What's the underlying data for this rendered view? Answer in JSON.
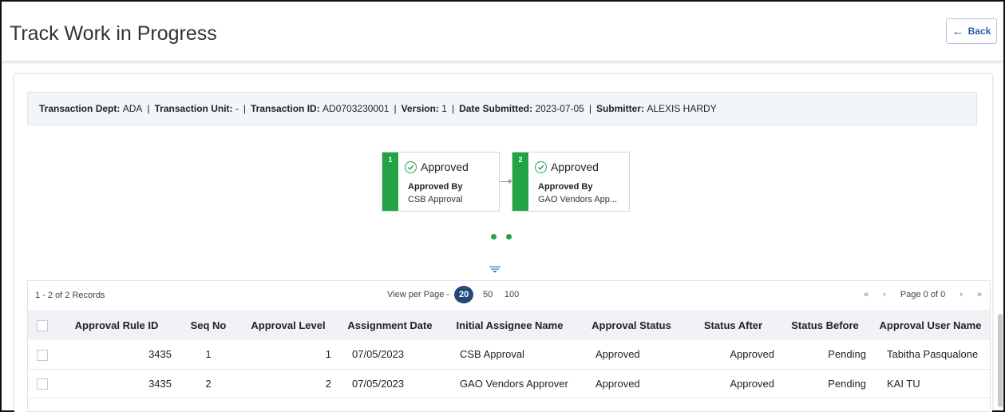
{
  "header": {
    "title": "Track Work in Progress",
    "back_label": "Back"
  },
  "summary": {
    "dept_label": "Transaction Dept:",
    "dept_value": "ADA",
    "unit_label": "Transaction Unit:",
    "unit_value": "-",
    "id_label": "Transaction ID:",
    "id_value": "AD0703230001",
    "version_label": "Version:",
    "version_value": "1",
    "date_label": "Date Submitted:",
    "date_value": "2023-07-05",
    "submitter_label": "Submitter:",
    "submitter_value": "ALEXIS HARDY",
    "separator": "|"
  },
  "workflow": {
    "steps": [
      {
        "number": "1",
        "status": "Approved",
        "by_label": "Approved By",
        "approver": "CSB Approval"
      },
      {
        "number": "2",
        "status": "Approved",
        "by_label": "Approved By",
        "approver": "GAO Vendors App..."
      }
    ]
  },
  "pager": {
    "records": "1 - 2 of 2 Records",
    "view_per_page": "View per Page -",
    "options": [
      "20",
      "50",
      "100"
    ],
    "selected": "20",
    "page_text": "Page 0 of 0"
  },
  "table": {
    "columns": [
      "Approval Rule ID",
      "Seq No",
      "Approval Level",
      "Assignment Date",
      "Initial Assignee Name",
      "Approval Status",
      "Status After",
      "Status Before",
      "Approval User Name"
    ],
    "rows": [
      {
        "rule_id": "3435",
        "seq": "1",
        "level": "1",
        "date": "07/05/2023",
        "assignee": "CSB Approval",
        "status": "Approved",
        "after": "Approved",
        "before": "Pending",
        "user": "Tabitha Pasqualone"
      },
      {
        "rule_id": "3435",
        "seq": "2",
        "level": "2",
        "date": "07/05/2023",
        "assignee": "GAO Vendors Approver",
        "status": "Approved",
        "after": "Approved",
        "before": "Pending",
        "user": "KAI TU"
      }
    ]
  },
  "colors": {
    "accent_green": "#22a446",
    "primary_blue": "#1f4a7a",
    "link_blue": "#2a5fa8"
  }
}
